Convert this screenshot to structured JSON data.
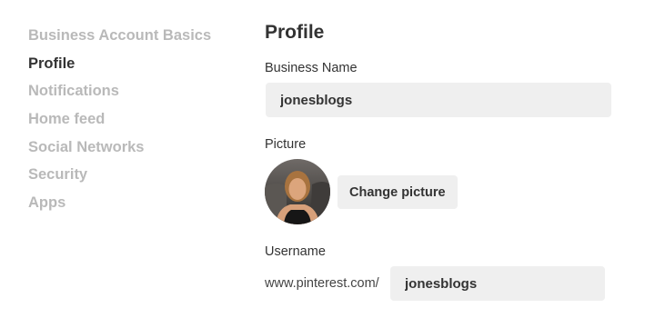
{
  "sidebar": {
    "items": [
      {
        "label": "Business Account Basics",
        "active": false
      },
      {
        "label": "Profile",
        "active": true
      },
      {
        "label": "Notifications",
        "active": false
      },
      {
        "label": "Home feed",
        "active": false
      },
      {
        "label": "Social Networks",
        "active": false
      },
      {
        "label": "Security",
        "active": false
      },
      {
        "label": "Apps",
        "active": false
      }
    ]
  },
  "main": {
    "title": "Profile",
    "business_name": {
      "label": "Business Name",
      "value": "jonesblogs"
    },
    "picture": {
      "label": "Picture",
      "button_label": "Change picture"
    },
    "username": {
      "label": "Username",
      "prefix": "www.pinterest.com/",
      "value": "jonesblogs"
    }
  },
  "colors": {
    "text_dark": "#333333",
    "nav_inactive": "#b9b9b9",
    "input_bg": "#efefef"
  }
}
